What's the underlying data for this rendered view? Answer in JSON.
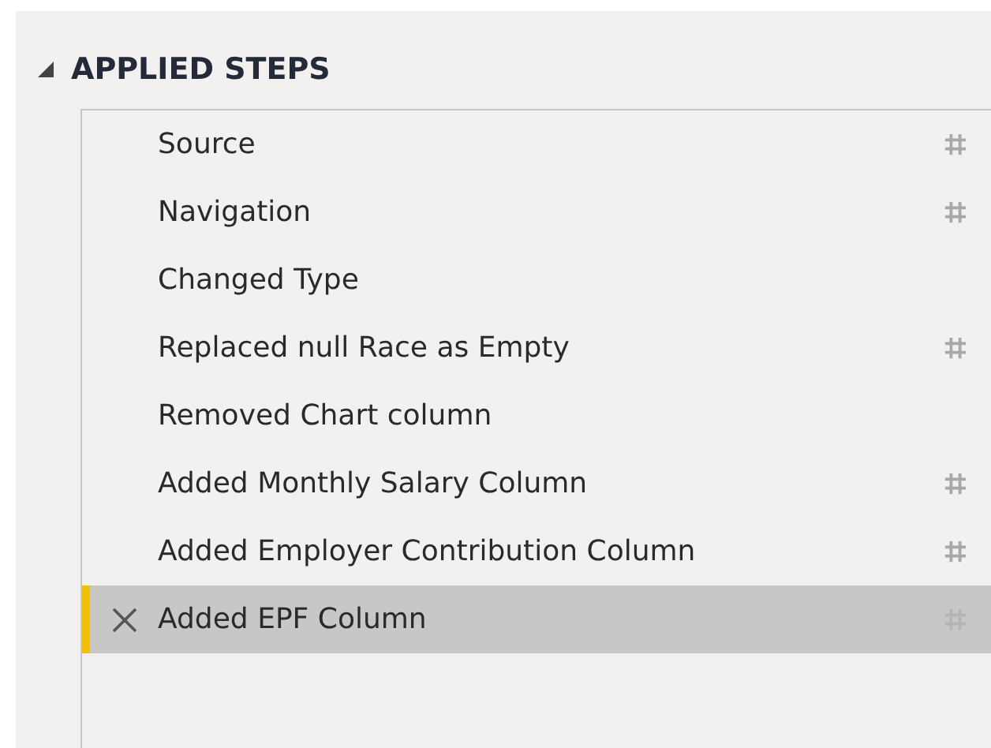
{
  "section": {
    "title": "APPLIED STEPS",
    "expanded": true
  },
  "steps": [
    {
      "label": "Source",
      "has_settings": true,
      "selected": false
    },
    {
      "label": "Navigation",
      "has_settings": true,
      "selected": false
    },
    {
      "label": "Changed Type",
      "has_settings": false,
      "selected": false
    },
    {
      "label": "Replaced null Race as Empty",
      "has_settings": true,
      "selected": false
    },
    {
      "label": "Removed Chart column",
      "has_settings": false,
      "selected": false
    },
    {
      "label": "Added Monthly Salary Column",
      "has_settings": true,
      "selected": false
    },
    {
      "label": "Added Employer Contribution Column",
      "has_settings": true,
      "selected": false
    },
    {
      "label": "Added EPF Column",
      "has_settings": true,
      "selected": true
    }
  ]
}
